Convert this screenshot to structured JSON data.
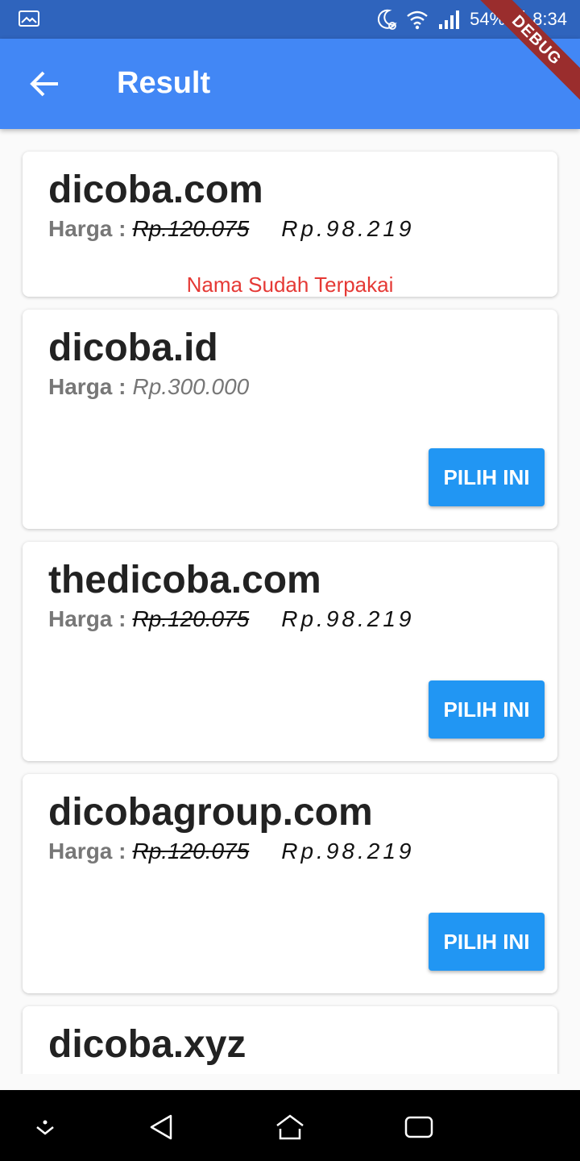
{
  "status_bar": {
    "battery": "54%",
    "time": "8:34",
    "icons": [
      "image-icon",
      "moon-icon",
      "alarm-icon",
      "wifi-icon",
      "signal-icon",
      "battery-icon"
    ]
  },
  "app_bar": {
    "title": "Result",
    "back_icon": "arrow-left-icon",
    "debug_banner": "DEBUG"
  },
  "results": [
    {
      "domain": "dicoba.com",
      "harga_label": "Harga :",
      "old_price": "Rp.120.075",
      "new_price": "Rp.98.219",
      "status": "Nama Sudah Terpakai"
    },
    {
      "domain": "dicoba.id",
      "harga_label": "Harga :",
      "price": "Rp.300.000",
      "button": "PILIH INI"
    },
    {
      "domain": "thedicoba.com",
      "harga_label": "Harga :",
      "old_price": "Rp.120.075",
      "new_price": "Rp.98.219",
      "button": "PILIH INI"
    },
    {
      "domain": "dicobagroup.com",
      "harga_label": "Harga :",
      "old_price": "Rp.120.075",
      "new_price": "Rp.98.219",
      "button": "PILIH INI"
    },
    {
      "domain": "dicoba.xyz"
    }
  ],
  "nav_bar": {
    "icons": [
      "chevron-down-icon",
      "back-triangle-icon",
      "home-icon",
      "recents-icon"
    ]
  },
  "colors": {
    "status_bar": "#2f64bd",
    "app_bar": "#4287f5",
    "button": "#2196f3",
    "taken_text": "#e53935"
  }
}
